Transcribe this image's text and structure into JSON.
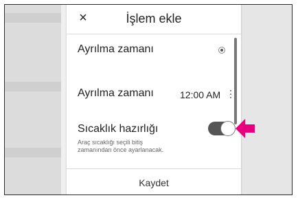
{
  "dialog": {
    "title": "İşlem ekle",
    "close_icon": "close-icon",
    "close_glyph": "×",
    "rows": {
      "departure_selected": {
        "label": "Ayrılma zamanı",
        "control": "radio-selected"
      },
      "departure_time": {
        "label": "Ayrılma zamanı",
        "value": "12:00 AM",
        "menu_icon": "more-vertical-icon"
      },
      "climate": {
        "label": "Sıcaklık hazırlığı",
        "description": "Araç sıcaklığı seçili bitiş zamanından önce ayarlanacak.",
        "toggle_on": true
      }
    },
    "save_label": "Kaydet"
  },
  "annotation": {
    "icon": "pointer-arrow-icon",
    "color": "#e6007e"
  },
  "colors": {
    "toggle_track": "#555555",
    "background": "#f0f0f0"
  }
}
